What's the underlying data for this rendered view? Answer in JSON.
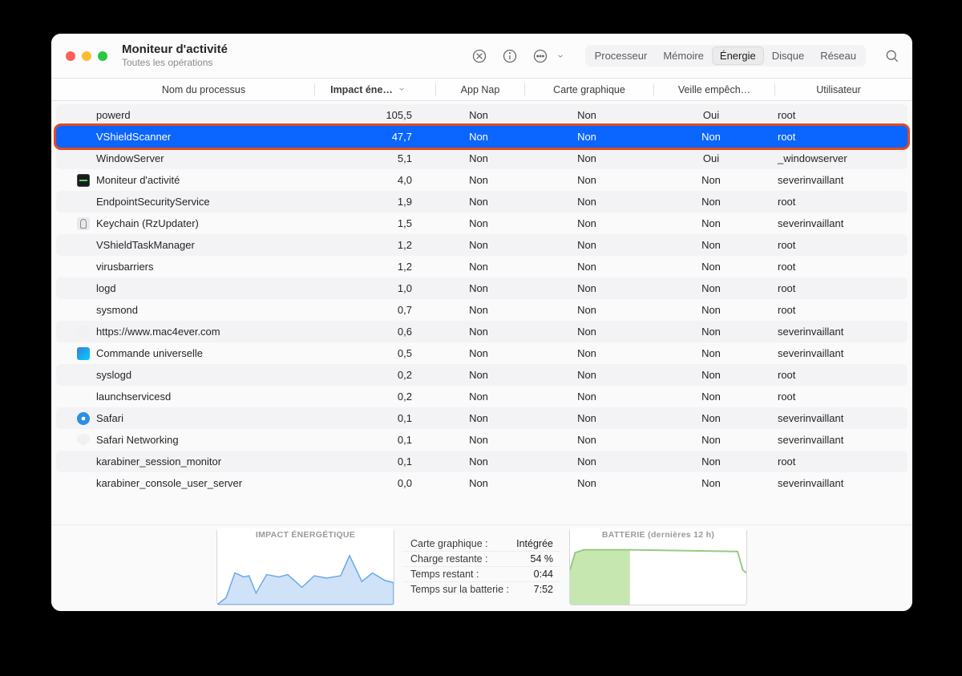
{
  "window": {
    "title": "Moniteur d'activité",
    "subtitle": "Toutes les opérations"
  },
  "tabs": {
    "items": [
      "Processeur",
      "Mémoire",
      "Énergie",
      "Disque",
      "Réseau"
    ],
    "active_index": 2
  },
  "columns": {
    "name": "Nom du processus",
    "impact": "Impact éne…",
    "nap": "App Nap",
    "gpu": "Carte graphique",
    "sleep": "Veille empêch…",
    "user": "Utilisateur"
  },
  "values": {
    "oui": "Oui",
    "non": "Non"
  },
  "rows": [
    {
      "icon": "",
      "name": "powerd",
      "impact": "105,5",
      "nap": "Non",
      "gpu": "Non",
      "sleep": "Oui",
      "user": "root",
      "alt": true
    },
    {
      "icon": "",
      "name": "VShieldScanner",
      "impact": "47,7",
      "nap": "Non",
      "gpu": "Non",
      "sleep": "Non",
      "user": "root",
      "selected": true
    },
    {
      "icon": "",
      "name": "WindowServer",
      "impact": "5,1",
      "nap": "Non",
      "gpu": "Non",
      "sleep": "Oui",
      "user": "_windowserver",
      "alt": true
    },
    {
      "icon": "activity",
      "name": "Moniteur d'activité",
      "impact": "4,0",
      "nap": "Non",
      "gpu": "Non",
      "sleep": "Non",
      "user": "severinvaillant"
    },
    {
      "icon": "",
      "name": "EndpointSecurityService",
      "impact": "1,9",
      "nap": "Non",
      "gpu": "Non",
      "sleep": "Non",
      "user": "root",
      "alt": true
    },
    {
      "icon": "keychain",
      "name": "Keychain (RzUpdater)",
      "impact": "1,5",
      "nap": "Non",
      "gpu": "Non",
      "sleep": "Non",
      "user": "severinvaillant"
    },
    {
      "icon": "",
      "name": "VShieldTaskManager",
      "impact": "1,2",
      "nap": "Non",
      "gpu": "Non",
      "sleep": "Non",
      "user": "root",
      "alt": true
    },
    {
      "icon": "",
      "name": "virusbarriers",
      "impact": "1,2",
      "nap": "Non",
      "gpu": "Non",
      "sleep": "Non",
      "user": "root"
    },
    {
      "icon": "",
      "name": "logd",
      "impact": "1,0",
      "nap": "Non",
      "gpu": "Non",
      "sleep": "Non",
      "user": "root",
      "alt": true
    },
    {
      "icon": "",
      "name": "sysmond",
      "impact": "0,7",
      "nap": "Non",
      "gpu": "Non",
      "sleep": "Non",
      "user": "root"
    },
    {
      "icon": "shield",
      "name": "https://www.mac4ever.com",
      "impact": "0,6",
      "nap": "Non",
      "gpu": "Non",
      "sleep": "Non",
      "user": "severinvaillant",
      "alt": true
    },
    {
      "icon": "universal",
      "name": "Commande universelle",
      "impact": "0,5",
      "nap": "Non",
      "gpu": "Non",
      "sleep": "Non",
      "user": "severinvaillant"
    },
    {
      "icon": "",
      "name": "syslogd",
      "impact": "0,2",
      "nap": "Non",
      "gpu": "Non",
      "sleep": "Non",
      "user": "root",
      "alt": true
    },
    {
      "icon": "",
      "name": "launchservicesd",
      "impact": "0,2",
      "nap": "Non",
      "gpu": "Non",
      "sleep": "Non",
      "user": "root"
    },
    {
      "icon": "safari",
      "name": "Safari",
      "impact": "0,1",
      "nap": "Non",
      "gpu": "Non",
      "sleep": "Non",
      "user": "severinvaillant",
      "alt": true
    },
    {
      "icon": "shield",
      "name": "Safari Networking",
      "impact": "0,1",
      "nap": "Non",
      "gpu": "Non",
      "sleep": "Non",
      "user": "severinvaillant"
    },
    {
      "icon": "",
      "name": "karabiner_session_monitor",
      "impact": "0,1",
      "nap": "Non",
      "gpu": "Non",
      "sleep": "Non",
      "user": "root",
      "alt": true
    },
    {
      "icon": "",
      "name": "karabiner_console_user_server",
      "impact": "0,0",
      "nap": "Non",
      "gpu": "Non",
      "sleep": "Non",
      "user": "severinvaillant"
    }
  ],
  "footer": {
    "energy_title": "IMPACT ÉNERGÉTIQUE",
    "battery_title": "BATTERIE (dernières 12 h)",
    "stats": [
      {
        "k": "Carte graphique :",
        "v": "Intégrée"
      },
      {
        "k": "Charge restante :",
        "v": "54 %"
      },
      {
        "k": "Temps restant :",
        "v": "0:44"
      },
      {
        "k": "Temps sur la batterie :",
        "v": "7:52"
      }
    ]
  },
  "chart_data": [
    {
      "type": "area",
      "title": "IMPACT ÉNERGÉTIQUE",
      "x": [
        0,
        5,
        10,
        15,
        18,
        22,
        28,
        35,
        40,
        48,
        55,
        62,
        70,
        75,
        82,
        88,
        95,
        100
      ],
      "values": [
        0,
        12,
        55,
        48,
        50,
        20,
        52,
        48,
        52,
        30,
        50,
        46,
        50,
        85,
        40,
        55,
        42,
        38
      ],
      "ylim": [
        0,
        100
      ]
    },
    {
      "type": "area",
      "title": "BATTERIE (dernières 12 h)",
      "series": [
        {
          "name": "charging",
          "x": [
            0,
            3,
            8,
            34,
            34
          ],
          "values": [
            60,
            90,
            95,
            95,
            0
          ]
        },
        {
          "name": "level",
          "x": [
            0,
            3,
            8,
            34,
            95,
            98,
            100
          ],
          "values": [
            60,
            90,
            95,
            95,
            92,
            60,
            55
          ]
        }
      ],
      "ylim": [
        0,
        100
      ]
    }
  ]
}
